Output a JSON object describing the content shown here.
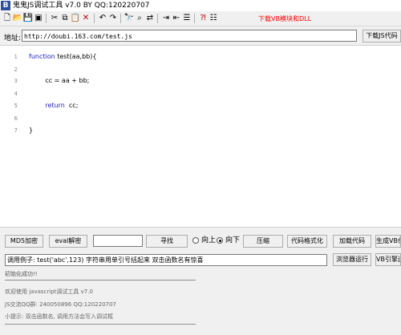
{
  "window": {
    "title": "鬼鬼JS调试工具 v7.0 BY QQ:120220707",
    "icon_letter": "B"
  },
  "toolbar": {
    "icons": [
      "new-file-icon",
      "open-folder-icon",
      "save-icon",
      "save-all-icon",
      "cut-icon",
      "copy-icon",
      "paste-icon",
      "delete-icon",
      "undo-icon",
      "redo-icon",
      "find-icon",
      "find-next-icon",
      "replace-icon",
      "indent-icon",
      "outdent-icon",
      "format-icon",
      "help-icon",
      "settings-icon"
    ],
    "download_vb_label": "下载VB模块和DLL"
  },
  "address": {
    "label": "地址:",
    "value": "http://doubi.163.com/test.js",
    "download_js_label": "下载JS代码"
  },
  "editor": {
    "lines": [
      {
        "num": "1",
        "text": "function test(aa,bb){"
      },
      {
        "num": "2",
        "text": ""
      },
      {
        "num": "3",
        "text": "        cc = aa + bb;"
      },
      {
        "num": "4",
        "text": ""
      },
      {
        "num": "5",
        "text": "        return  cc;"
      },
      {
        "num": "6",
        "text": ""
      },
      {
        "num": "7",
        "text": "}"
      }
    ]
  },
  "controls": {
    "md5_label": "MD5加密",
    "eval_label": "eval解密",
    "find_value": "",
    "find_label": "寻找",
    "up_label": "向上",
    "down_label": "向下",
    "direction_selected": "down",
    "compress_label": "压缩",
    "format_label": "代码格式化",
    "load_label": "加载代码",
    "gen_vb_label": "生成VB代码"
  },
  "call": {
    "value": "调用例子: test('abc',123) 字符串用单引号括起来 双击函数名有惊喜",
    "browser_run_label": "浏览器运行",
    "vb_engine_label": "VB引擎运行"
  },
  "output": {
    "lines": [
      "初始化成功!!",
      "欢迎使用 javascript调试工具 v7.0",
      "JS交流QQ群: 240050896  QQ:120220707",
      "小提示: 双击函数名, 调用方法会写入调试框"
    ]
  },
  "colors": {
    "keyword": "#1c1cc8",
    "download_link": "#ff0000",
    "app_icon": "#2d4f9e"
  }
}
